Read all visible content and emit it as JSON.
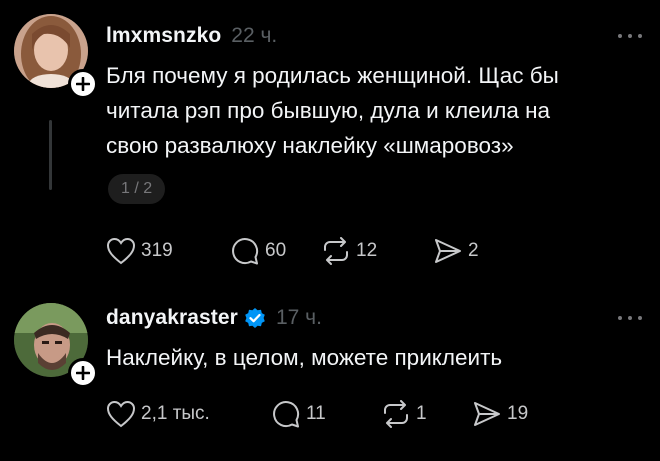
{
  "posts": [
    {
      "username": "lmxmsnzko",
      "time": "22 ч.",
      "verified": false,
      "text_lines": [
        "Бля почему я родилась женщиной. Щас бы",
        "читала рэп про бывшую, дула и клеила на",
        "свою развалюху наклейку «шмаровоз»"
      ],
      "pager": "1 / 2",
      "likes": "319",
      "replies": "60",
      "reposts": "12",
      "shares": "2"
    },
    {
      "username": "danyakraster",
      "time": "17 ч.",
      "verified": true,
      "text_lines": [
        "Наклейку, в целом, можете приклеить"
      ],
      "likes": "2,1 тыс.",
      "replies": "11",
      "reposts": "1",
      "shares": "19"
    }
  ],
  "icons": {
    "like": "heart-icon",
    "reply": "comment-bubble-icon",
    "repost": "repost-icon",
    "share": "send-icon",
    "follow": "plus-icon",
    "more": "more-dots-icon",
    "verified": "verified-badge-icon"
  },
  "colors": {
    "background": "#000000",
    "text": "#f3f5f7",
    "muted": "#5a5f63",
    "verified": "#0095f6"
  }
}
